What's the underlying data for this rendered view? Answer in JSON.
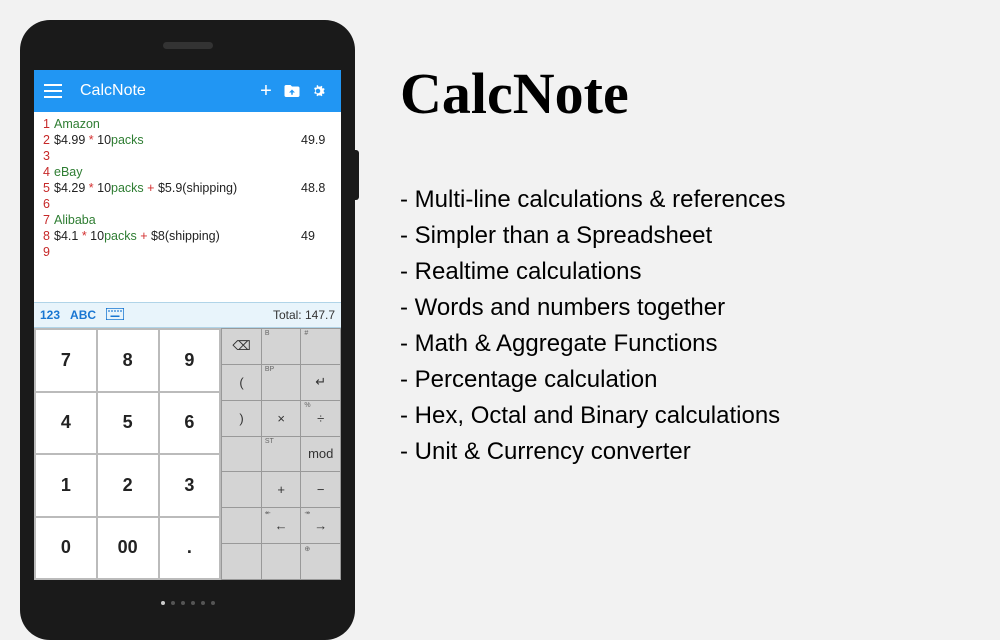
{
  "appbar": {
    "title": "CalcNote",
    "plus": "+"
  },
  "editor": {
    "lines": [
      {
        "n": "1",
        "html": "<span class='tok-label'>Amazon</span>",
        "result": ""
      },
      {
        "n": "2",
        "html": "<span class='tok-num'>$4.99 </span><span class='tok-op'>*</span><span class='tok-num'> 10</span><span class='tok-word'>packs</span>",
        "result": "49.9"
      },
      {
        "n": "3",
        "html": "",
        "result": ""
      },
      {
        "n": "4",
        "html": "<span class='tok-label'>eBay</span>",
        "result": ""
      },
      {
        "n": "5",
        "html": "<span class='tok-num'>$4.29 </span><span class='tok-op'>*</span><span class='tok-num'> 10</span><span class='tok-word'>packs</span><span class='tok-op'> + </span><span class='tok-num'>$5.9</span><span class='tok-paren'>(shipping)</span>",
        "result": "48.8"
      },
      {
        "n": "6",
        "html": "",
        "result": ""
      },
      {
        "n": "7",
        "html": "<span class='tok-label'>Alibaba</span>",
        "result": ""
      },
      {
        "n": "8",
        "html": "<span class='tok-num'>$4.1 </span><span class='tok-op'>*</span><span class='tok-num'> 10</span><span class='tok-word'>packs</span><span class='tok-op'> + </span><span class='tok-num'>$8</span><span class='tok-paren'>(shipping)</span>",
        "result": "49"
      },
      {
        "n": "9",
        "html": "",
        "result": ""
      }
    ]
  },
  "midbar": {
    "mode_num": "123",
    "mode_abc": "ABC",
    "total_label": "Total: 147.7"
  },
  "numpad": [
    "7",
    "8",
    "9",
    "4",
    "5",
    "6",
    "1",
    "2",
    "3",
    "0",
    "00",
    "."
  ],
  "oppad": [
    {
      "sup": "",
      "sym": "⌫"
    },
    {
      "sup": "B",
      "sym": ""
    },
    {
      "sup": "#",
      "sym": ""
    },
    {
      "sup": "",
      "sym": "("
    },
    {
      "sup": "BP",
      "sym": ""
    },
    {
      "sup": "",
      "sym": "↵"
    },
    {
      "sup": "",
      "sym": ")"
    },
    {
      "sup": "",
      "sym": "×"
    },
    {
      "sup": "%",
      "sym": "÷"
    },
    {
      "sup": "",
      "sym": ""
    },
    {
      "sup": "ST",
      "sym": ""
    },
    {
      "sup": "",
      "sym": "mod"
    },
    {
      "sup": "",
      "sym": ""
    },
    {
      "sup": "",
      "sym": "+"
    },
    {
      "sup": "",
      "sym": "−"
    },
    {
      "sup": "",
      "sym": ""
    },
    {
      "sup": "↞",
      "sym": "←"
    },
    {
      "sup": "↠",
      "sym": "→"
    },
    {
      "sup": "",
      "sym": ""
    },
    {
      "sup": "",
      "sym": ""
    },
    {
      "sup": "⊕",
      "sym": ""
    }
  ],
  "marketing": {
    "title": "CalcNote",
    "features": [
      "Multi-line calculations & references",
      "Simpler than a Spreadsheet",
      "Realtime calculations",
      "Words and numbers together",
      "Math & Aggregate Functions",
      "Percentage calculation",
      "Hex, Octal and Binary calculations",
      "Unit & Currency converter"
    ]
  }
}
